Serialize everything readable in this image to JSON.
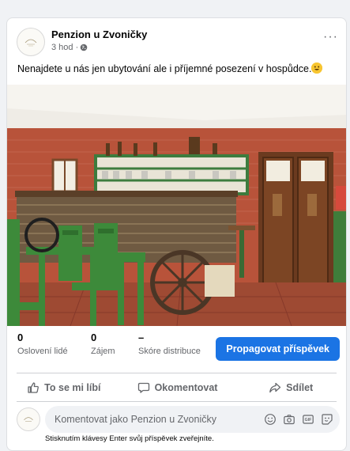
{
  "post": {
    "page_name": "Penzion u Zvoničky",
    "time": "3 hod ·",
    "more_label": "···",
    "text": "Nenajdete u nás jen ubytování ale i příjemné posezení v hospůdce.",
    "image_alt": "Interiér hospůdky s barem a dřevěným vozem"
  },
  "stats": {
    "reached": {
      "value": "0",
      "label": "Oslovení lidé"
    },
    "engagement": {
      "value": "0",
      "label": "Zájem"
    },
    "distribution": {
      "value": "–",
      "label": "Skóre distribuce"
    },
    "promote_label": "Propagovat příspěvek"
  },
  "actions": {
    "like": "To se mi líbí",
    "comment": "Okomentovat",
    "share": "Sdílet"
  },
  "comment": {
    "placeholder": "Komentovat jako Penzion u Zvoničky",
    "hint": "Stisknutím klávesy Enter svůj příspěvek zveřejníte.",
    "icons": [
      "smiley-icon",
      "camera-icon",
      "gif-icon",
      "sticker-icon"
    ]
  },
  "colors": {
    "accent": "#1b74e4",
    "muted_text": "#65676b",
    "background": "#f0f2f5"
  }
}
